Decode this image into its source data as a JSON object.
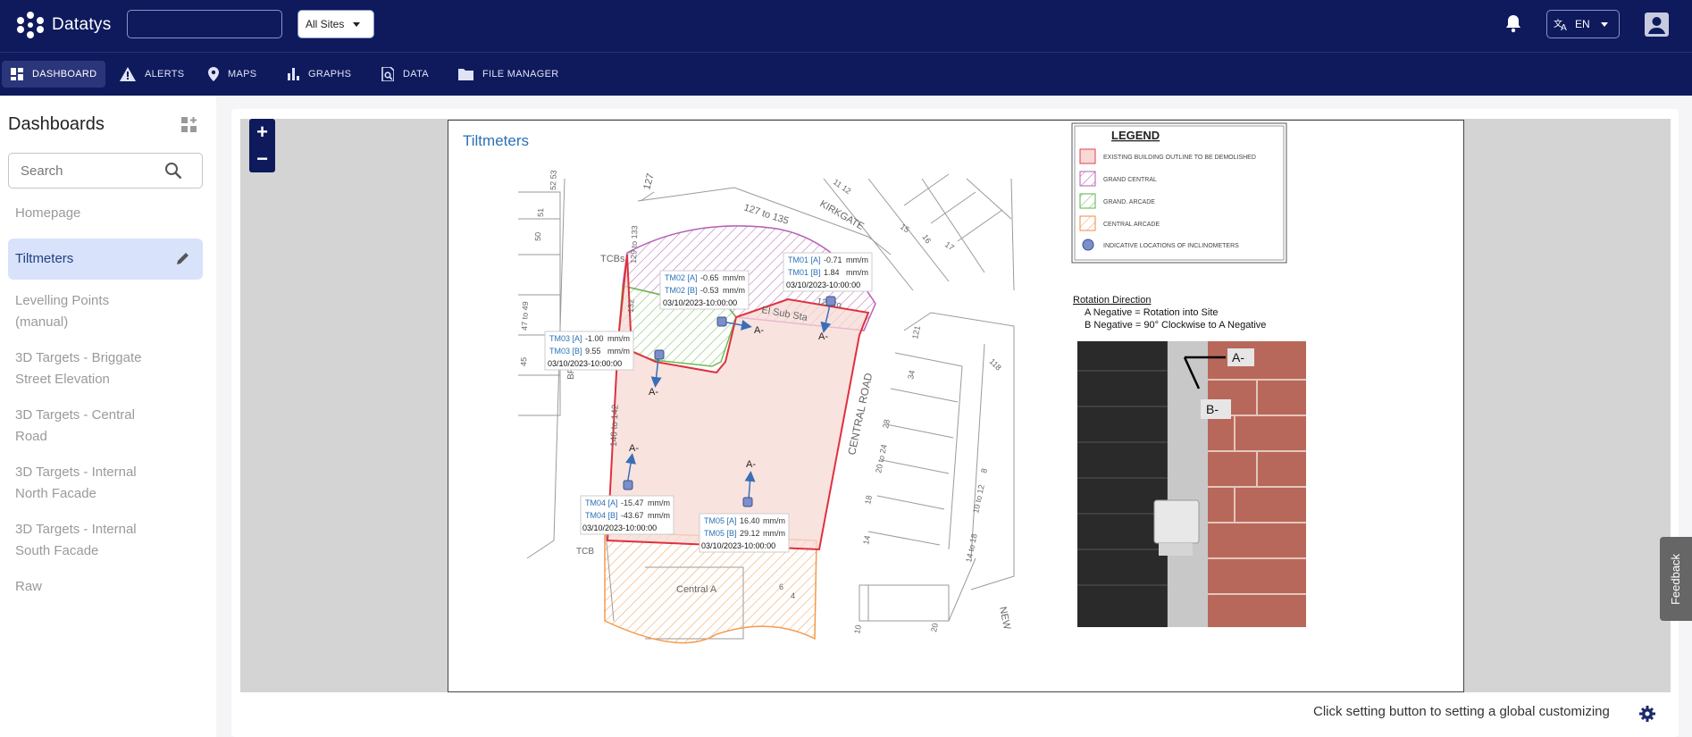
{
  "app": {
    "name": "Datatys"
  },
  "header": {
    "search_value": "",
    "site_select": "All Sites",
    "language": "EN"
  },
  "nav": {
    "items": [
      {
        "label": "DASHBOARD",
        "icon": "dashboard-icon"
      },
      {
        "label": "ALERTS",
        "icon": "warning-icon"
      },
      {
        "label": "MAPS",
        "icon": "map-pin-icon"
      },
      {
        "label": "GRAPHS",
        "icon": "bar-chart-icon"
      },
      {
        "label": "DATA",
        "icon": "data-search-icon"
      },
      {
        "label": "FILE MANAGER",
        "icon": "folder-icon"
      }
    ]
  },
  "sidebar": {
    "title": "Dashboards",
    "search_placeholder": "Search",
    "items": [
      {
        "label": "Homepage"
      },
      {
        "label": "Tiltmeters"
      },
      {
        "label": "Levelling Points (manual)"
      },
      {
        "label": "3D Targets - Briggate Street Elevation"
      },
      {
        "label": "3D Targets - Central Road"
      },
      {
        "label": "3D Targets - Internal North Facade"
      },
      {
        "label": "3D Targets - Internal South Facade"
      },
      {
        "label": "Raw"
      }
    ]
  },
  "main": {
    "zoom_in": "+",
    "zoom_out": "−",
    "drawing_title": "Tiltmeters",
    "footer_note": "Click setting button to setting a global customizing",
    "feedback": "Feedback"
  },
  "legend": {
    "title": "LEGEND",
    "entries": [
      {
        "label": "EXISTING BUILDING OUTLINE TO BE DEMOLISHED",
        "color": "#e04050"
      },
      {
        "label": "GRAND CENTRAL",
        "color": "#b05cb0"
      },
      {
        "label": "GRAND. ARCADE",
        "color": "#5fb24a"
      },
      {
        "label": "CENTRAL ARCADE",
        "color": "#f08a3c"
      },
      {
        "label": "INDICATIVE LOCATIONS OF INCLINOMETERS",
        "color": "#5a6fb5"
      }
    ]
  },
  "rotation": {
    "heading": "Rotation Direction",
    "line_a": "A Negative = Rotation into Site",
    "line_b": "B Negative = 90° Clockwise to A Negative",
    "photo_label_a": "A-",
    "photo_label_b": "B-"
  },
  "sensors": [
    {
      "a_name": "TM01 [A]",
      "a_value": "-0.71",
      "b_name": "TM01 [B]",
      "b_value": "1.84",
      "unit": "mm/m",
      "time": "03/10/2023-10:00:00"
    },
    {
      "a_name": "TM02 [A]",
      "a_value": "-0.65",
      "b_name": "TM02 [B]",
      "b_value": "-0.53",
      "unit": "mm/m",
      "time": "03/10/2023-10:00:00"
    },
    {
      "a_name": "TM03 [A]",
      "a_value": "-1.00",
      "b_name": "TM03 [B]",
      "b_value": "9.55",
      "unit": "mm/m",
      "time": "03/10/2023-10:00:00"
    },
    {
      "a_name": "TM04 [A]",
      "a_value": "-15.47",
      "b_name": "TM04 [B]",
      "b_value": "-43.67",
      "unit": "mm/m",
      "time": "03/10/2023-10:00:00"
    },
    {
      "a_name": "TM05 [A]",
      "a_value": "16.40",
      "b_name": "TM05 [B]",
      "b_value": "29.12",
      "unit": "mm/m",
      "time": "03/10/2023-10:00:00"
    }
  ],
  "map_labels": {
    "arrow": "A-",
    "kirkgate": "KIRKGATE",
    "central_road": "CENTRAL ROAD",
    "el_sub_sta": "El Sub Sta",
    "tcbs_1": "TCBs",
    "tcbs_2": "TCB",
    "num_127": "127",
    "num_127_135": "127 to 135",
    "num_127_to": "127 to",
    "num_129_133": "129 to 133",
    "num_132": "132",
    "num_140_142": "140 to 142",
    "num_47_49": "47 to 49",
    "num_45": "45",
    "num_50": "50",
    "num_51": "51",
    "num_52_53": "52 53",
    "num_11_12": "11 12",
    "num_15": "15",
    "num_16": "16",
    "num_17": "17",
    "num_121": "121",
    "num_118": "118",
    "num_34": "34",
    "num_28": "28",
    "num_20_24": "20 to 24",
    "num_18": "18",
    "num_14": "14",
    "num_8": "8",
    "num_10_12": "10 to 12",
    "num_14_18": "14 to 18",
    "num_10": "10",
    "num_20": "20",
    "new": "NEW",
    "central_a": "Central A",
    "br": "BR",
    "num_6": "6",
    "num_4": "4"
  }
}
